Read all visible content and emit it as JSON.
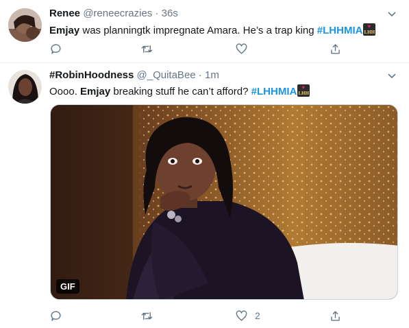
{
  "tweets": [
    {
      "display_name": "Renee",
      "handle": "@reneecrazies",
      "time": "36s",
      "text_lead": "Emjay",
      "text_rest": " was planningtk impregnate Amara. He’s a trap king ",
      "hashtag": "#LHHMIA",
      "emoji": "i-love-lhh-icon",
      "actions": {
        "reply": "",
        "retweet": "",
        "like": "",
        "share": ""
      }
    },
    {
      "display_name": "#RobinHoodness",
      "handle": "@_QuitaBee",
      "time": "1m",
      "text_pre": "Oooo. ",
      "text_lead": "Emjay",
      "text_rest": " breaking stuff he can’t afford? ",
      "hashtag": "#LHHMIA",
      "emoji": "i-love-lhh-icon",
      "media": {
        "type": "gif",
        "badge": "GIF"
      },
      "actions": {
        "reply": "",
        "retweet": "",
        "like": "2",
        "share": ""
      }
    }
  ],
  "separator": " · ",
  "colors": {
    "link": "#1b95e0",
    "muted": "#657786",
    "divider": "#e6ecf0"
  }
}
